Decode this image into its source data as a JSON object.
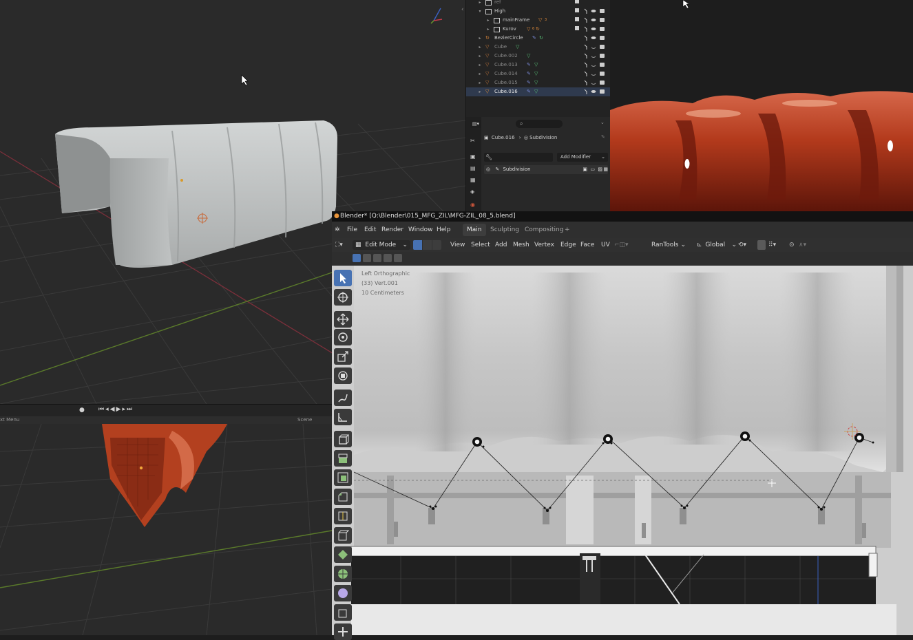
{
  "window": {
    "title": "Blender* [Q:\\Blender\\015_MFG_ZIL\\MFG-ZIL_08_5.blend]",
    "menus": [
      "File",
      "Edit",
      "Render",
      "Window",
      "Help"
    ],
    "workspace_tabs": [
      {
        "label": "Main",
        "active": true
      },
      {
        "label": "Sculpting",
        "active": false
      },
      {
        "label": "Compositing",
        "active": false
      }
    ],
    "add_tab_symbol": "+"
  },
  "header3d": {
    "mode": "Edit Mode",
    "menus": [
      "View",
      "Select",
      "Add",
      "Mesh",
      "Vertex",
      "Edge",
      "Face",
      "UV"
    ],
    "addon_menu": "RanTools",
    "transform_orientation": "Global"
  },
  "viewport_overlay": {
    "view_name": "Left Orthographic",
    "selection_info": "(33) Vert.001",
    "scale_info": "10 Centimeters"
  },
  "outliner": {
    "rows": [
      {
        "label": "ref",
        "dim": true,
        "expanded": false
      },
      {
        "label": "High",
        "dim": false,
        "expanded": true
      },
      {
        "label": "mainFrame",
        "dim": false,
        "expanded": false,
        "child_count": "3"
      },
      {
        "label": "Kurov",
        "dim": false,
        "expanded": false,
        "child_count": "6"
      },
      {
        "label": "BezierCircle",
        "dim": false,
        "expanded": false
      },
      {
        "label": "Cube",
        "dim": true,
        "expanded": false
      },
      {
        "label": "Cube.002",
        "dim": true,
        "expanded": false
      },
      {
        "label": "Cube.013",
        "dim": true,
        "expanded": false
      },
      {
        "label": "Cube.014",
        "dim": true,
        "expanded": false
      },
      {
        "label": "Cube.015",
        "dim": true,
        "expanded": false
      },
      {
        "label": "Cube.016",
        "dim": false,
        "expanded": false
      }
    ]
  },
  "properties": {
    "object_name": "Cube.016",
    "modifier_breadcrumb": "Subdivision",
    "add_modifier_label": "Add Modifier",
    "modifier_name": "Subdivision"
  },
  "timeline_area": {
    "status_left": "xt Menu",
    "status_right": "Scene Collection"
  },
  "colors": {
    "accent": "#4772b3",
    "render_red": "#c23d1a",
    "cloth_grey": "#b9bcbc"
  }
}
